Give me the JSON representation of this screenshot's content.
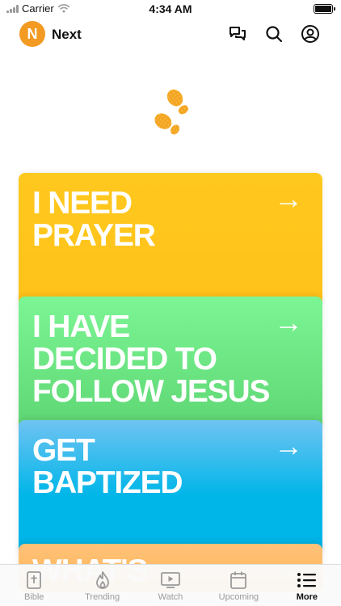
{
  "status_bar": {
    "carrier": "Carrier",
    "time": "4:34 AM"
  },
  "header": {
    "logo_letter": "N",
    "title": "Next",
    "icons": [
      "chat-bubbles-icon",
      "search-icon",
      "profile-icon"
    ]
  },
  "hero_icon": "footsteps-icon",
  "colors": {
    "brand": "#f29a22",
    "prayer": "#ffc81e",
    "follow": "#6ce383",
    "baptized": "#00b6e9",
    "whats": "#ffbb66",
    "active_tab": "#111111",
    "inactive_tab": "#9a9a9a"
  },
  "cards": [
    {
      "title": "I NEED\nPRAYER",
      "arrow": "→"
    },
    {
      "title": "I HAVE\nDECIDED TO\nFOLLOW JESUS",
      "arrow": "→"
    },
    {
      "title": "GET\nBAPTIZED",
      "arrow": "→"
    },
    {
      "title": "WHAT'S",
      "arrow": "→"
    }
  ],
  "tabs": [
    {
      "label": "Bible",
      "icon": "bible-icon",
      "active": false
    },
    {
      "label": "Trending",
      "icon": "flame-icon",
      "active": false
    },
    {
      "label": "Watch",
      "icon": "play-screen-icon",
      "active": false
    },
    {
      "label": "Upcoming",
      "icon": "calendar-icon",
      "active": false
    },
    {
      "label": "More",
      "icon": "list-icon",
      "active": true
    }
  ]
}
